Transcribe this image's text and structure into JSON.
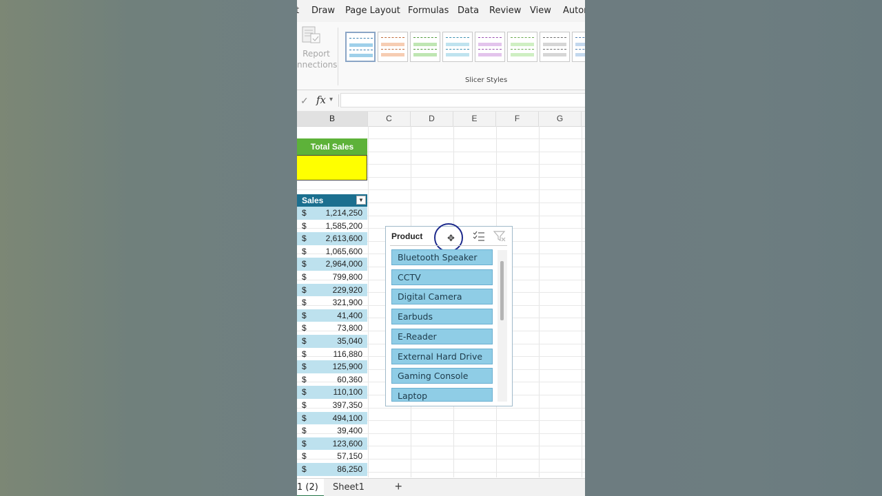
{
  "ribbon": {
    "tabs": [
      "t",
      "Draw",
      "Page Layout",
      "Formulas",
      "Data",
      "Review",
      "View",
      "Autor"
    ],
    "report_connections": [
      "Report",
      "nnections"
    ],
    "slicer_styles_label": "Slicer Styles",
    "styles": [
      {
        "name": "light-blue",
        "band": "#9fd0ea",
        "dash": "#3a7fb0"
      },
      {
        "name": "light-orange",
        "band": "#f6cdb3",
        "dash": "#c06a3a"
      },
      {
        "name": "light-green",
        "band": "#bfe6b3",
        "dash": "#4f9a3a"
      },
      {
        "name": "light-teal",
        "band": "#bfe3ef",
        "dash": "#3a8fb0"
      },
      {
        "name": "light-purple",
        "band": "#e3c4ec",
        "dash": "#9a4fb0"
      },
      {
        "name": "light-lime",
        "band": "#cfefc3",
        "dash": "#6aaa4f"
      },
      {
        "name": "light-gray",
        "band": "#d6d6d6",
        "dash": "#6a6a6a"
      },
      {
        "name": "light-blue-2",
        "band": "#c3d8ee",
        "dash": "#4f7fb0"
      }
    ]
  },
  "formula_bar": {
    "fx": "fx",
    "value": ""
  },
  "columns": [
    "B",
    "C",
    "D",
    "E",
    "F",
    "G"
  ],
  "total_sales": {
    "header": "Total Sales",
    "value": ""
  },
  "sales": {
    "header": "Sales",
    "currency": "$",
    "values": [
      "1,214,250",
      "1,585,200",
      "2,613,600",
      "1,065,600",
      "2,964,000",
      "799,800",
      "229,920",
      "321,900",
      "41,400",
      "73,800",
      "35,040",
      "116,880",
      "125,900",
      "60,360",
      "110,100",
      "397,350",
      "494,100",
      "39,400",
      "123,600",
      "57,150",
      "86,250"
    ]
  },
  "slicer": {
    "title": "Product",
    "items": [
      "Bluetooth Speaker",
      "CCTV",
      "Digital Camera",
      "Earbuds",
      "E-Reader",
      "External Hard Drive",
      "Gaming Console",
      "Laptop"
    ]
  },
  "sheets": {
    "tabs": [
      "1 (2)",
      "Sheet1"
    ],
    "add": "+"
  },
  "colors": {
    "total_header": "#5db239",
    "total_value": "#ffff00",
    "sales_header": "#1b6f8f",
    "sales_band": "#bde1ee",
    "slicer_item": "#8fcde6"
  }
}
